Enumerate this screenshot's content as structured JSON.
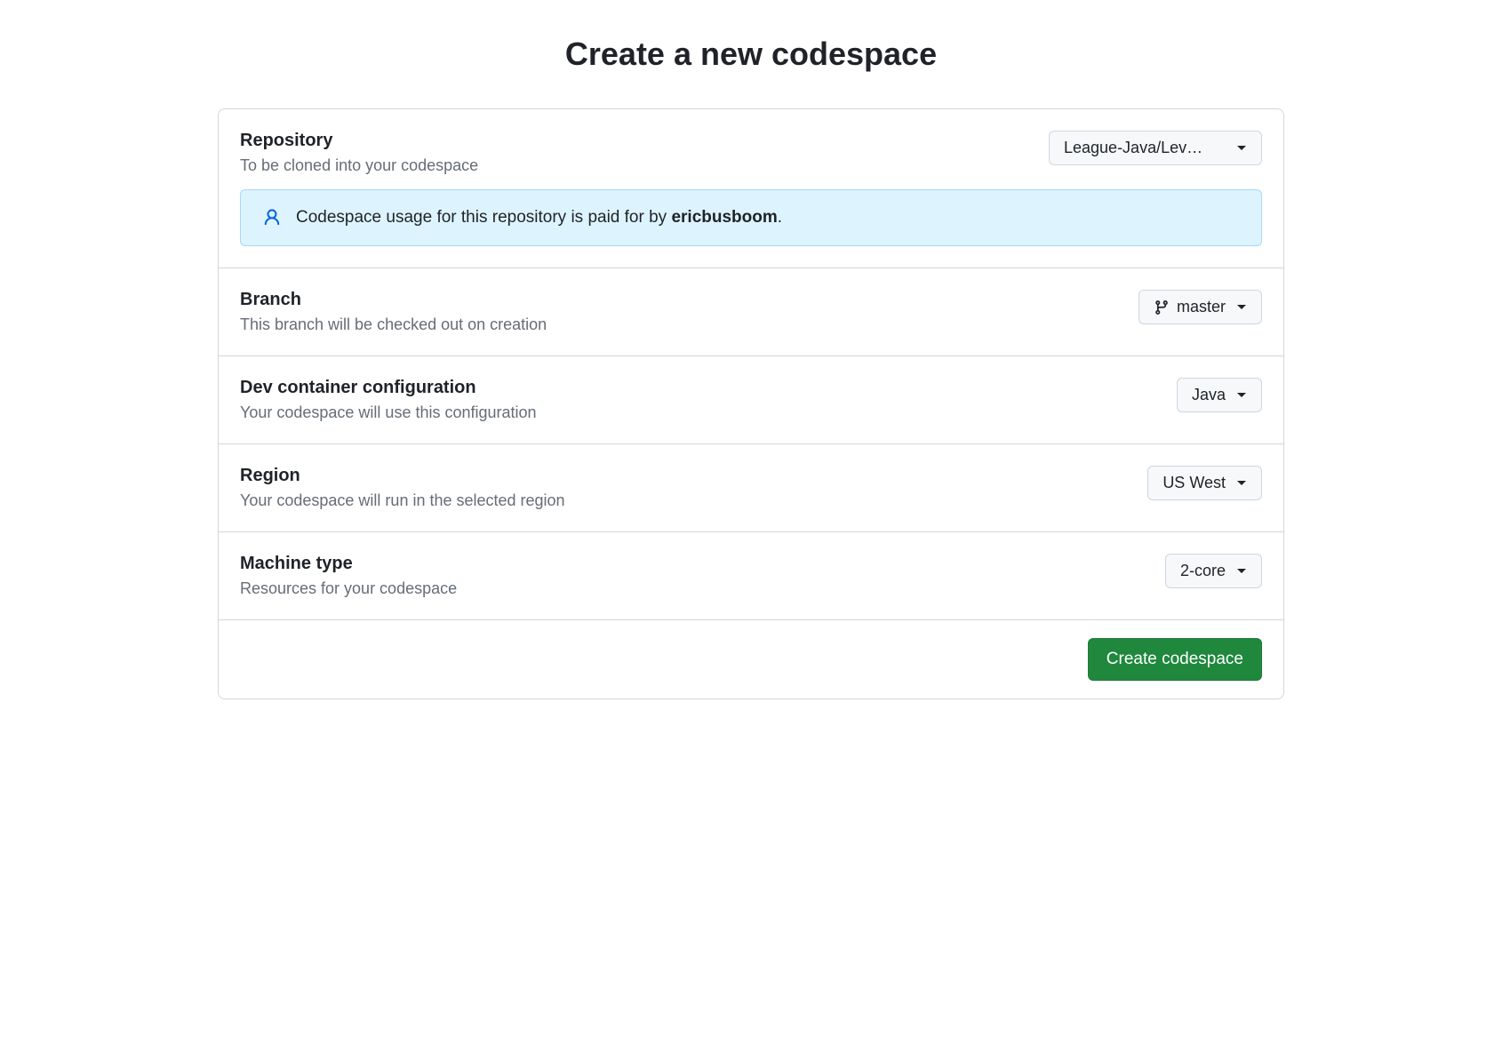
{
  "page_title": "Create a new codespace",
  "repository": {
    "label": "Repository",
    "description": "To be cloned into your codespace",
    "selected": "League-Java/Lev…"
  },
  "notice": {
    "prefix": "Codespace usage for this repository is paid for by ",
    "payer": "ericbusboom",
    "suffix": "."
  },
  "branch": {
    "label": "Branch",
    "description": "This branch will be checked out on creation",
    "selected": "master"
  },
  "devcontainer": {
    "label": "Dev container configuration",
    "description": "Your codespace will use this configuration",
    "selected": "Java"
  },
  "region": {
    "label": "Region",
    "description": "Your codespace will run in the selected region",
    "selected": "US West"
  },
  "machine": {
    "label": "Machine type",
    "description": "Resources for your codespace",
    "selected": "2-core"
  },
  "submit_label": "Create codespace"
}
